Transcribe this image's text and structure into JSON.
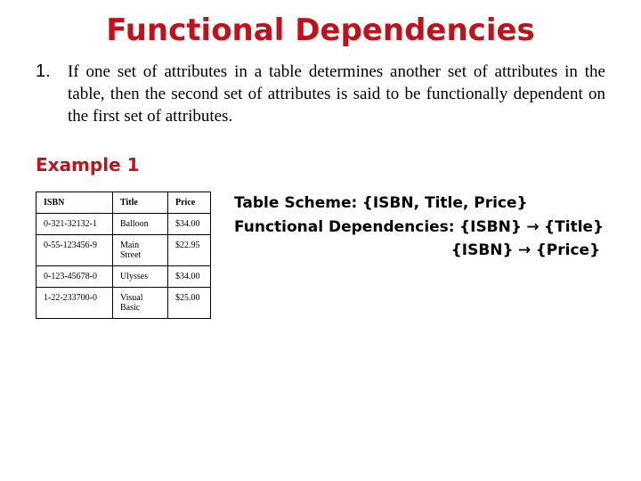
{
  "title": "Functional Dependencies",
  "definition": {
    "num": "1.",
    "text": "If one set of attributes in a table determines another set of attributes in the table, then the second set of attributes is said to be functionally dependent on the first set of attributes."
  },
  "example_label": "Example 1",
  "table": {
    "headers": [
      "ISBN",
      "Title",
      "Price"
    ],
    "rows": [
      [
        "0-321-32132-1",
        "Balloon",
        "$34.00"
      ],
      [
        "0-55-123456-9",
        "Main Street",
        "$22.95"
      ],
      [
        "0-123-45678-0",
        "Ulysses",
        "$34.00"
      ],
      [
        "1-22-233700-0",
        "Visual Basic",
        "$25.00"
      ]
    ]
  },
  "fd": {
    "scheme_label": "Table Scheme:",
    "scheme_value": "{ISBN, Title, Price}",
    "fd_label": "Functional Dependencies:",
    "fd1_lhs": "{ISBN}",
    "arrow": "→",
    "fd1_rhs": "{Title}",
    "fd2_lhs": "{ISBN}",
    "fd2_rhs": "{Price}"
  }
}
